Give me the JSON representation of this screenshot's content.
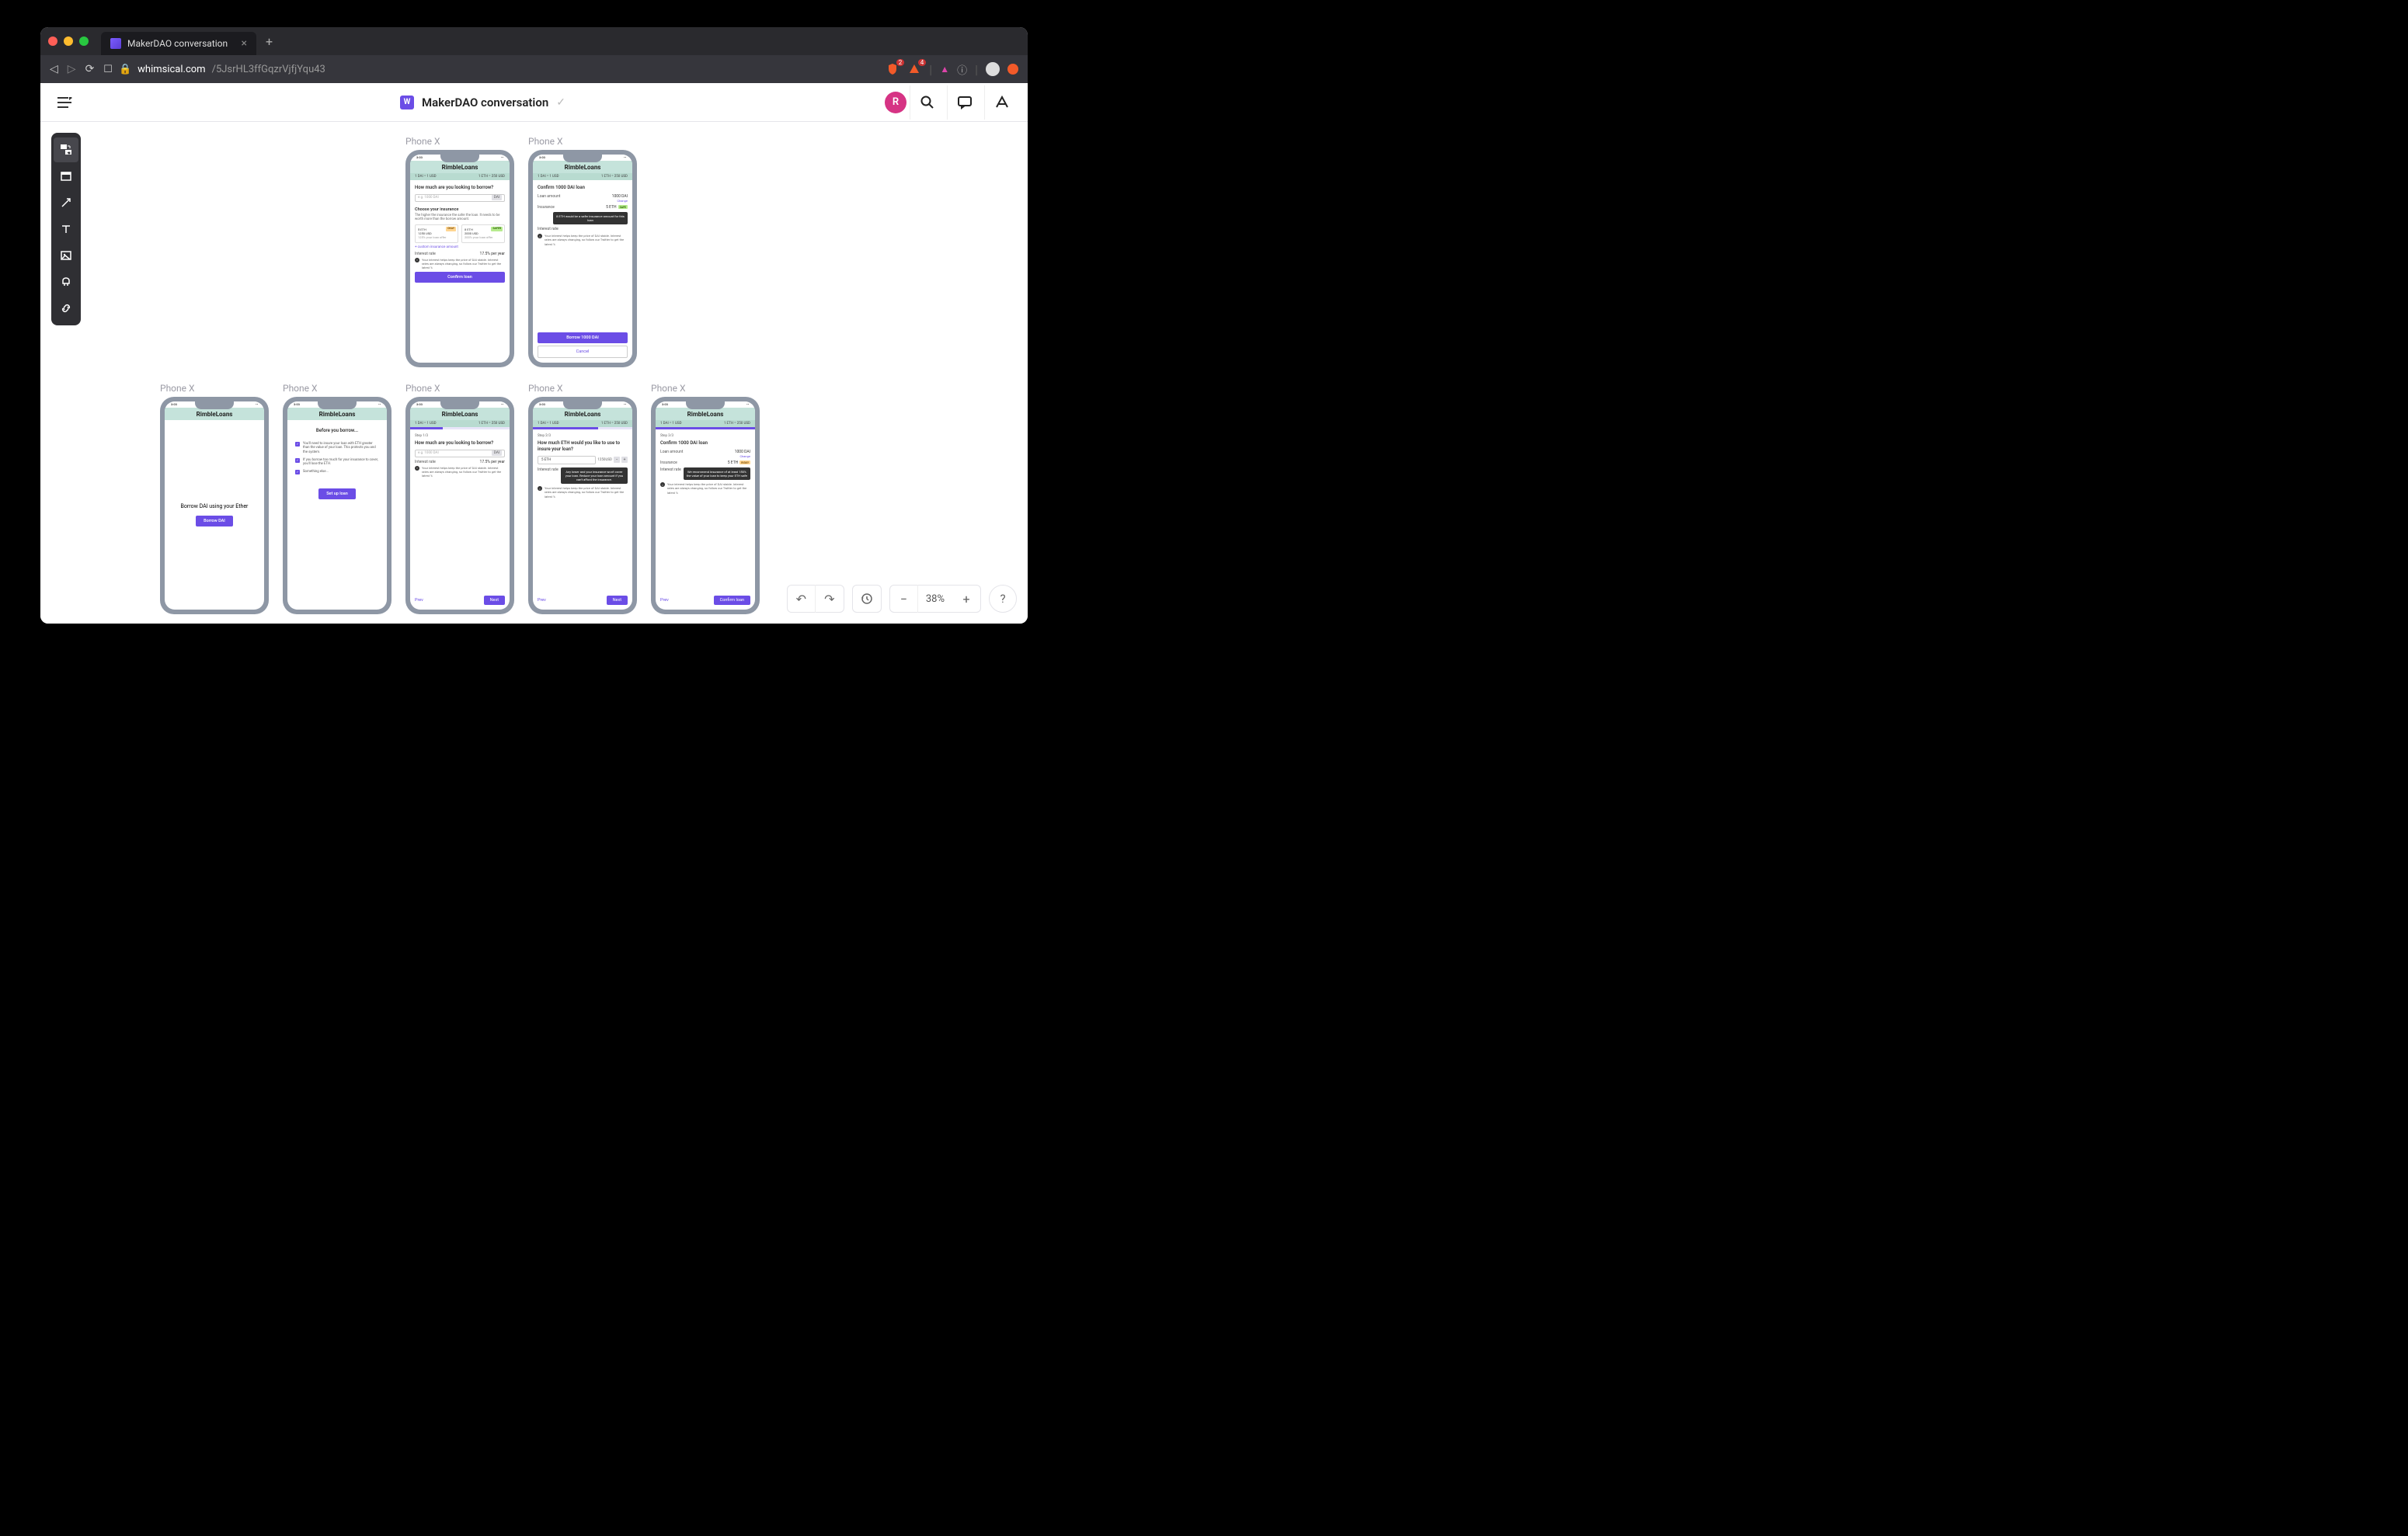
{
  "browser": {
    "tab_title": "MakerDAO conversation",
    "url_domain": "whimsical.com",
    "url_path": "/5JsrHL3ffGqzrVjfjYqu43",
    "shield_count": "2",
    "badge_count": "4"
  },
  "app": {
    "workspace_initial": "W",
    "doc_title": "MakerDAO conversation",
    "user_initial": "R",
    "zoom": "38%"
  },
  "frames": {
    "label": "Phone X",
    "common": {
      "time": "3:03",
      "app_name": "RimbleLoans",
      "rate1": "1 DAI = 1 USD",
      "rate2": "1 ETH = 250 USD",
      "info_text": "Your interest helps keep the price of DAI stable. Interest rates are always changing, so follow our Twitter to get the latest %"
    },
    "f1": {
      "heading": "How much are you looking to borrow?",
      "placeholder": "e.g. 1000 DAI",
      "suffix": "DAI",
      "insurance_title": "Choose your insurance",
      "insurance_sub": "The higher the insurance the safer the loan. It needs to be worth more than the borrow amount.",
      "card1_amount": "5 ETH",
      "card1_usd": "1250 USD",
      "card1_note": "125% your loan offer",
      "card1_badge": "OKAY",
      "card2_amount": "8 ETH",
      "card2_usd": "2000 USD",
      "card2_note": "200% your loan offer",
      "card2_badge": "SAFER",
      "custom_link": "+ custom insurance amount",
      "interest_label": "Interest rate",
      "interest_value": "17.5% per year",
      "confirm_btn": "Confirm loan"
    },
    "f2": {
      "heading": "Confirm 1000 DAI loan",
      "loan_label": "Loan amount",
      "loan_value": "1000 DAI",
      "change": "Change",
      "insurance_label": "Insurance",
      "insurance_value": "5 ETH",
      "insurance_badge": "SAFE",
      "tooltip": "8 ETH would be a safer insurance amount for this loan",
      "interest_label": "Interest rate",
      "borrow_btn": "Borrow 1000 DAI",
      "cancel_btn": "Cancel"
    },
    "f3": {
      "heading": "Borrow DAI using your Ether",
      "btn": "Borrow DAI"
    },
    "f4": {
      "heading": "Before you borrow...",
      "check1": "You'll need to insure your loan with ETH greater than the value of your loan. This protects you and the system.",
      "check2": "If you borrow too much for your insurance to cover, you'll lose the ETH.",
      "check3": "Something else...",
      "btn": "Set up loan"
    },
    "f5": {
      "step": "Step 1/3",
      "heading": "How much are you looking to borrow?",
      "placeholder": "e.g. 1000 DAI",
      "suffix": "DAI",
      "interest_label": "Interest rate",
      "interest_value": "17.5% per year",
      "prev": "Prev",
      "next": "Next"
    },
    "f6": {
      "step": "Step 2/3",
      "heading": "How much ETH would you like to use to insure your loan?",
      "amount": "5 ETH",
      "converted": "1250USD",
      "tooltip": "Any lower and your insurance won't cover your loan. Reduce your loan amount if you can't afford the insurance.",
      "interest_label": "Interest rate",
      "prev": "Prev",
      "next": "Next"
    },
    "f7": {
      "step": "Step 3/3",
      "heading": "Confirm 1000 DAI loan",
      "loan_label": "Loan amount",
      "loan_value": "1000 DAI",
      "change": "Change",
      "insurance_label": "Insurance",
      "insurance_value": "5 ETH",
      "insurance_badge": "RISKY",
      "tooltip": "We recommend insurance of at least 150% the value of your loan to keep your ETH safe",
      "interest_label": "Interest rate",
      "prev": "Prev",
      "confirm": "Confirm loan"
    }
  }
}
